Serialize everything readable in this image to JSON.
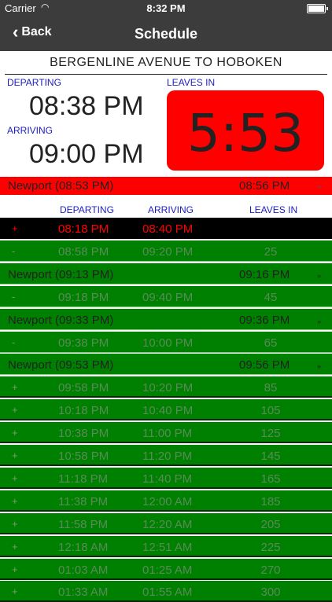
{
  "status": {
    "carrier": "Carrier",
    "time": "8:32 PM"
  },
  "nav": {
    "back_label": "Back",
    "title": "Schedule"
  },
  "route_title": "BERGENLINE AVENUE TO HOBOKEN",
  "summary": {
    "departing_label": "DEPARTING",
    "departing_time": "08:38 PM",
    "arriving_label": "ARRIVING",
    "arriving_time": "09:00 PM",
    "leaves_label": "LEAVES IN",
    "leaves_value": "5:53"
  },
  "transfer_highlight": {
    "station": "Newport (08:53 PM)",
    "time": "08:56 PM",
    "arrow": "»"
  },
  "headers": {
    "departing": "DEPARTING",
    "arriving": "ARRIVING",
    "leaves": "LEAVES IN"
  },
  "rows": [
    {
      "kind": "trip",
      "style": "black",
      "sign": "+",
      "depart": "08:18 PM",
      "arrive": "08:40 PM",
      "leaves": ""
    },
    {
      "kind": "trip",
      "style": "green",
      "sign": "-",
      "depart": "08:58 PM",
      "arrive": "09:20 PM",
      "leaves": "25"
    },
    {
      "kind": "transfer",
      "station": "Newport (09:13 PM)",
      "time": "09:16 PM",
      "arrow": "»"
    },
    {
      "kind": "trip",
      "style": "green",
      "sign": "-",
      "depart": "09:18 PM",
      "arrive": "09:40 PM",
      "leaves": "45"
    },
    {
      "kind": "transfer",
      "station": "Newport (09:33 PM)",
      "time": "09:36 PM",
      "arrow": "»"
    },
    {
      "kind": "trip",
      "style": "green",
      "sign": "-",
      "depart": "09:38 PM",
      "arrive": "10:00 PM",
      "leaves": "65"
    },
    {
      "kind": "transfer",
      "station": "Newport (09:53 PM)",
      "time": "09:56 PM",
      "arrow": "»"
    },
    {
      "kind": "trip",
      "style": "dark",
      "sign": "+",
      "depart": "09:58 PM",
      "arrive": "10:20 PM",
      "leaves": "85"
    },
    {
      "kind": "trip",
      "style": "dark",
      "sign": "+",
      "depart": "10:18 PM",
      "arrive": "10:40 PM",
      "leaves": "105"
    },
    {
      "kind": "trip",
      "style": "dark",
      "sign": "+",
      "depart": "10:38 PM",
      "arrive": "11:00 PM",
      "leaves": "125"
    },
    {
      "kind": "trip",
      "style": "dark",
      "sign": "+",
      "depart": "10:58 PM",
      "arrive": "11:20 PM",
      "leaves": "145"
    },
    {
      "kind": "trip",
      "style": "dark",
      "sign": "+",
      "depart": "11:18 PM",
      "arrive": "11:40 PM",
      "leaves": "165"
    },
    {
      "kind": "trip",
      "style": "dark",
      "sign": "+",
      "depart": "11:38 PM",
      "arrive": "12:00 AM",
      "leaves": "185"
    },
    {
      "kind": "trip",
      "style": "dark",
      "sign": "+",
      "depart": "11:58 PM",
      "arrive": "12:20 AM",
      "leaves": "205"
    },
    {
      "kind": "trip",
      "style": "dark",
      "sign": "+",
      "depart": "12:18 AM",
      "arrive": "12:51 AM",
      "leaves": "225"
    },
    {
      "kind": "trip",
      "style": "dark",
      "sign": "+",
      "depart": "01:03 AM",
      "arrive": "01:25 AM",
      "leaves": "270"
    },
    {
      "kind": "trip",
      "style": "dark",
      "sign": "+",
      "depart": "01:33 AM",
      "arrive": "01:55 AM",
      "leaves": "300"
    }
  ],
  "colors": {
    "bar": "#3c3c3c",
    "green": "#008000",
    "red": "#ff0000",
    "label_blue": "#1d1dbf",
    "dim_text": "#5a8a5a"
  }
}
